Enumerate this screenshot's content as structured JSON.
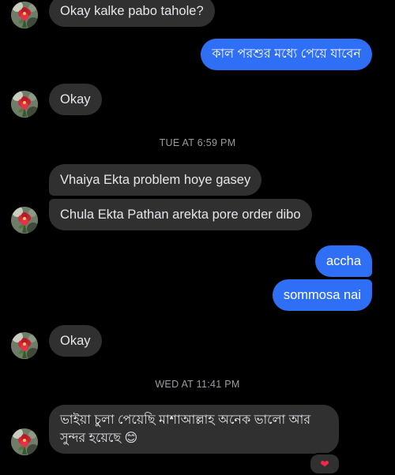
{
  "messages": {
    "m1": "Okay kalke pabo tahole?",
    "m2": "কাল পরশুর মধ্যে পেয়ে যাবেন",
    "m3": "Okay",
    "m4": "Vhaiya Ekta problem hoye gasey",
    "m5": "Chula Ekta Pathan arekta pore order dibo",
    "m6": "accha",
    "m7": "sommosa nai",
    "m8": "Okay",
    "m9": "ভাইয়া চুলা পেয়েছি মাশাআল্লাহ অনেক ভালো আর সুন্দর হয়েছে 😊"
  },
  "timestamps": {
    "t1": "TUE AT 6:59 PM",
    "t2": "WED AT 11:41 PM"
  },
  "reaction": {
    "emoji": "❤",
    "color": "#f02849"
  },
  "colors": {
    "incoming_bubble": "#303030",
    "outgoing_bubble": "#2f6ff5",
    "background": "#000000",
    "timestamp_text": "#9a9da2"
  },
  "icons": {
    "avatar": "contact-avatar-flower-icon",
    "reaction": "heart-reaction-icon"
  }
}
